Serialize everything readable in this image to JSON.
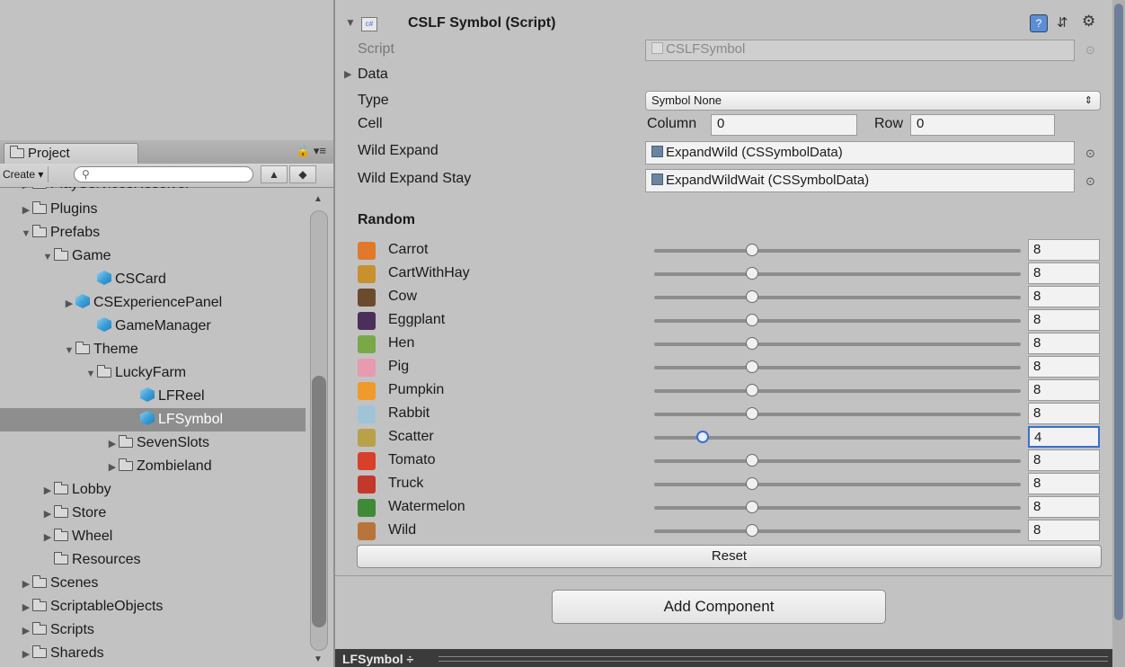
{
  "project": {
    "tab_label": "Project",
    "tab_icons": "🔒 ▾≡",
    "create_label": "Create ▾",
    "search_placeholder": "",
    "partial_top_item": "PlayServicesResolver",
    "tree": [
      {
        "label": "Plugins",
        "type": "folder",
        "arrow": "▶",
        "indent": 0
      },
      {
        "label": "Prefabs",
        "type": "folder",
        "arrow": "▼",
        "indent": 0
      },
      {
        "label": "Game",
        "type": "folder",
        "arrow": "▼",
        "indent": 1
      },
      {
        "label": "CSCard",
        "type": "prefab",
        "arrow": "",
        "indent": 3
      },
      {
        "label": "CSExperiencePanel",
        "type": "prefab",
        "arrow": "▶",
        "indent": 2
      },
      {
        "label": "GameManager",
        "type": "prefab",
        "arrow": "",
        "indent": 3
      },
      {
        "label": "Theme",
        "type": "folder",
        "arrow": "▼",
        "indent": 2
      },
      {
        "label": "LuckyFarm",
        "type": "folder",
        "arrow": "▼",
        "indent": 3
      },
      {
        "label": "LFReel",
        "type": "prefab",
        "arrow": "",
        "indent": 5
      },
      {
        "label": "LFSymbol",
        "type": "prefab",
        "arrow": "",
        "indent": 5,
        "selected": true
      },
      {
        "label": "SevenSlots",
        "type": "folder",
        "arrow": "▶",
        "indent": 4
      },
      {
        "label": "Zombieland",
        "type": "folder",
        "arrow": "▶",
        "indent": 4
      },
      {
        "label": "Lobby",
        "type": "folder",
        "arrow": "▶",
        "indent": 1
      },
      {
        "label": "Store",
        "type": "folder",
        "arrow": "▶",
        "indent": 1
      },
      {
        "label": "Wheel",
        "type": "folder",
        "arrow": "▶",
        "indent": 1
      },
      {
        "label": "Resources",
        "type": "folder",
        "arrow": "",
        "indent": 1
      },
      {
        "label": "Scenes",
        "type": "folder",
        "arrow": "▶",
        "indent": 0
      },
      {
        "label": "ScriptableObjects",
        "type": "folder",
        "arrow": "▶",
        "indent": 0
      },
      {
        "label": "Scripts",
        "type": "folder",
        "arrow": "▶",
        "indent": 0
      },
      {
        "label": "Shareds",
        "type": "folder",
        "arrow": "▶",
        "indent": 0
      }
    ]
  },
  "inspector": {
    "component_title": "CSLF Symbol (Script)",
    "script_label": "Script",
    "script_value": "CSLFSymbol",
    "data_label": "Data",
    "type_label": "Type",
    "type_value": "Symbol None",
    "cell_label": "Cell",
    "column_label": "Column",
    "column_value": "0",
    "row_label": "Row",
    "row_value": "0",
    "wild_expand_label": "Wild Expand",
    "wild_expand_value": "ExpandWild (CSSymbolData)",
    "wild_expand_stay_label": "Wild Expand Stay",
    "wild_expand_stay_value": "ExpandWildWait (CSSymbolData)",
    "random_label": "Random",
    "slider_max": 30,
    "symbols": [
      {
        "name": "Carrot",
        "value": "8",
        "color": "#e07a2a"
      },
      {
        "name": "CartWithHay",
        "value": "8",
        "color": "#c9902e"
      },
      {
        "name": "Cow",
        "value": "8",
        "color": "#6b4a2e"
      },
      {
        "name": "Eggplant",
        "value": "8",
        "color": "#4a2f5a"
      },
      {
        "name": "Hen",
        "value": "8",
        "color": "#7aa846"
      },
      {
        "name": "Pig",
        "value": "8",
        "color": "#e79ab0"
      },
      {
        "name": "Pumpkin",
        "value": "8",
        "color": "#f09a2c"
      },
      {
        "name": "Rabbit",
        "value": "8",
        "color": "#9fc4d8"
      },
      {
        "name": "Scatter",
        "value": "4",
        "color": "#b9a14a",
        "active": true
      },
      {
        "name": "Tomato",
        "value": "8",
        "color": "#d8402a"
      },
      {
        "name": "Truck",
        "value": "8",
        "color": "#c2392b"
      },
      {
        "name": "Watermelon",
        "value": "8",
        "color": "#3e8a36"
      },
      {
        "name": "Wild",
        "value": "8",
        "color": "#b8743a"
      }
    ],
    "reset_label": "Reset",
    "add_component_label": "Add Component",
    "bottom_tab_label": "LFSymbol ÷"
  }
}
